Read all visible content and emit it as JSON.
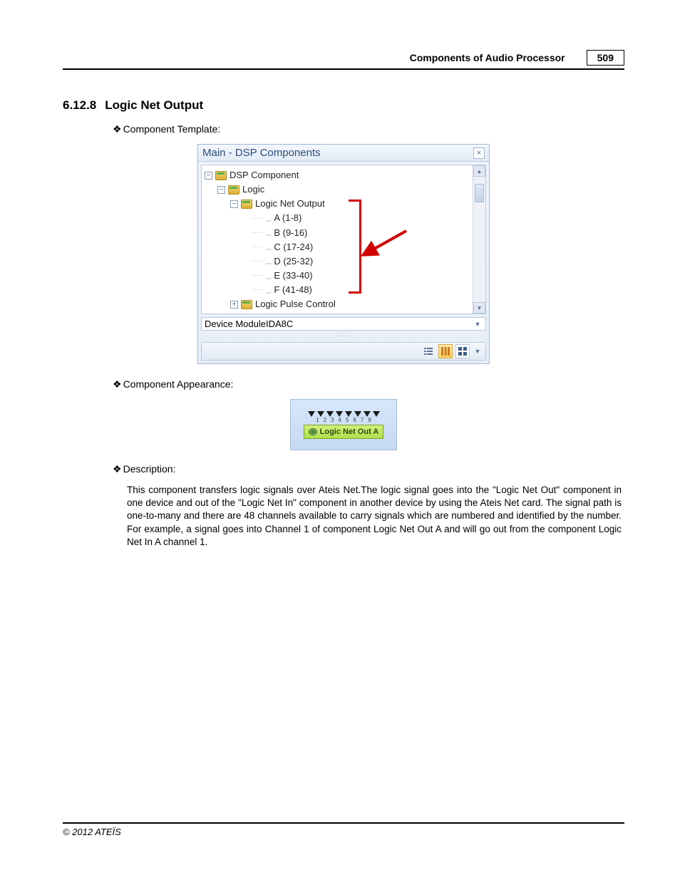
{
  "header": {
    "title": "Components of Audio Processor",
    "page_number": "509"
  },
  "section": {
    "number": "6.12.8",
    "title": "Logic Net Output"
  },
  "bullets": {
    "template": "Component Template:",
    "appearance": "Component Appearance:",
    "description": "Description:"
  },
  "panel": {
    "title": "Main - DSP Components",
    "tree": {
      "root": "DSP Component",
      "logic": "Logic",
      "lno": "Logic Net Output",
      "items": [
        "A (1-8)",
        "B (9-16)",
        "C (17-24)",
        "D (25-32)",
        "E (33-40)",
        "F (41-48)"
      ],
      "pulse": "Logic Pulse Control"
    },
    "device_label": "Device Module",
    "device_value": "IDA8C"
  },
  "component": {
    "badge": "Logic Net Out A",
    "pins": [
      "1",
      "2",
      "3",
      "4",
      "5",
      "6",
      "7",
      "8"
    ]
  },
  "description_text": "This component transfers logic signals over Ateis Net.The logic signal goes into the \"Logic Net Out\" component in one device and out of the \"Logic Net In\" component in another device by using the Ateis Net card. The signal path is one-to-many and there are 48 channels available to carry signals which are numbered and identified by the number. For example, a signal goes into Channel 1 of component Logic Net Out A and will go out from  the component Logic Net In A channel 1.",
  "footer": {
    "copyright": "© 2012 ATEÏS"
  }
}
